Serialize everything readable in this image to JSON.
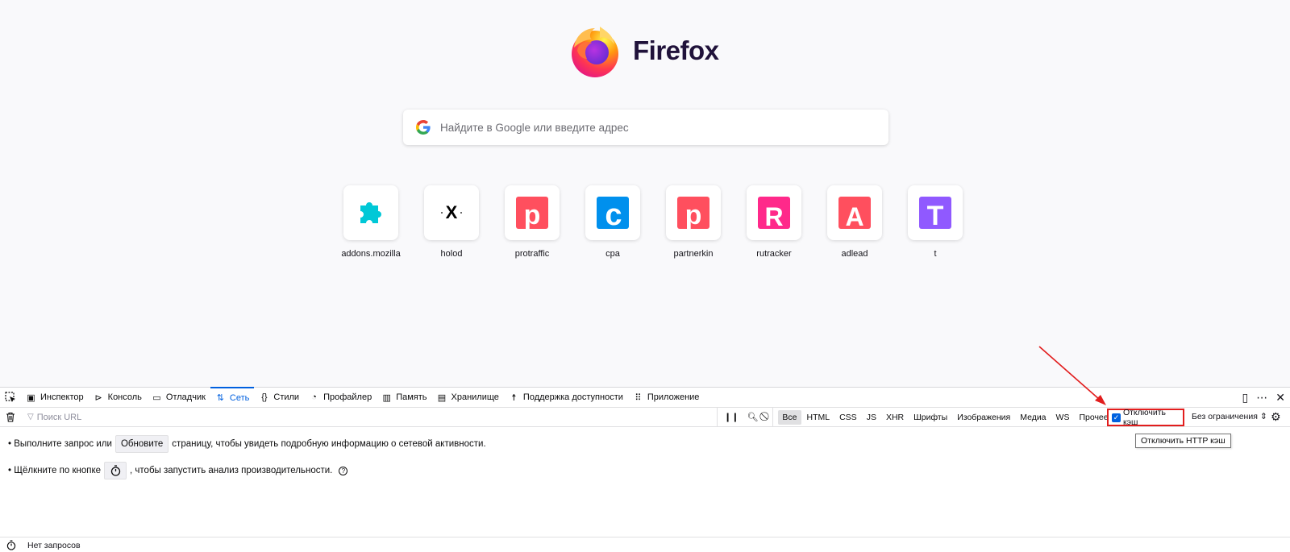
{
  "newtab": {
    "brand_name": "Firefox",
    "search_placeholder": "Найдите в Google или введите адрес",
    "tiles": [
      {
        "label": "addons.mozilla",
        "icon": "puzzle-icon",
        "color": "#00c8d7"
      },
      {
        "label": "holod",
        "icon": "x-letter-icon",
        "color": "#000000"
      },
      {
        "label": "protraffic",
        "icon": "p-letter-icon",
        "color": "#ff4f5e"
      },
      {
        "label": "cpa",
        "icon": "c-letter-icon",
        "color": "#0090ed"
      },
      {
        "label": "partnerkin",
        "icon": "p-letter-icon",
        "color": "#ff4f5e"
      },
      {
        "label": "rutracker",
        "icon": "r-letter-icon",
        "color": "#ff298a"
      },
      {
        "label": "adlead",
        "icon": "a-letter-icon",
        "color": "#ff4f5e"
      },
      {
        "label": "t",
        "icon": "t-letter-icon",
        "color": "#9059ff"
      }
    ]
  },
  "devtools": {
    "tabs": [
      {
        "label": "Инспектор",
        "icon": "inspector-icon"
      },
      {
        "label": "Консоль",
        "icon": "console-icon"
      },
      {
        "label": "Отладчик",
        "icon": "debugger-icon"
      },
      {
        "label": "Сеть",
        "icon": "network-icon",
        "selected": true
      },
      {
        "label": "Стили",
        "icon": "style-editor-icon"
      },
      {
        "label": "Профайлер",
        "icon": "profiler-icon"
      },
      {
        "label": "Память",
        "icon": "memory-icon"
      },
      {
        "label": "Хранилище",
        "icon": "storage-icon"
      },
      {
        "label": "Поддержка доступности",
        "icon": "accessibility-icon"
      },
      {
        "label": "Приложение",
        "icon": "application-icon"
      }
    ],
    "filter_placeholder": "Поиск URL",
    "type_filters": [
      "Все",
      "HTML",
      "CSS",
      "JS",
      "XHR",
      "Шрифты",
      "Изображения",
      "Медиа",
      "WS",
      "Прочее"
    ],
    "disable_cache_label": "Отключить кэш",
    "disable_cache_checked": true,
    "throttle_label": "Без ограничения",
    "tooltip": "Отключить HTTP кэш",
    "hint1_before": "• Выполните запрос или",
    "hint1_button": "Обновите",
    "hint1_after": "страницу, чтобы увидеть подробную информацию о сетевой активности.",
    "hint2_before": "• Щёлкните по кнопке",
    "hint2_after": ", чтобы запустить анализ производительности.",
    "status": "Нет запросов",
    "accent_color": "#0060df",
    "highlight_color": "#e21d1d"
  }
}
